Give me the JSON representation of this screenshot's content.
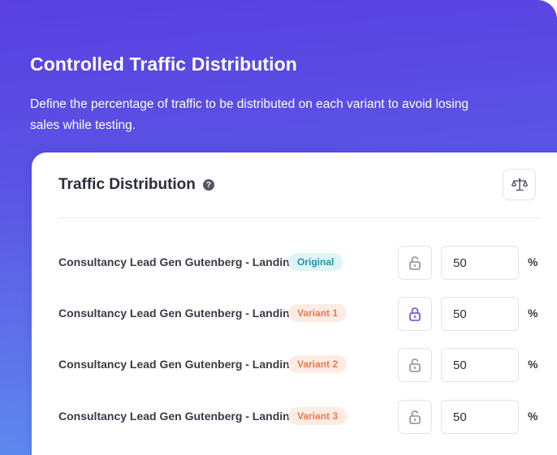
{
  "hero": {
    "title": "Controlled Traffic Distribution",
    "description": "Define the percentage of traffic to be distributed on each variant to avoid losing sales while testing."
  },
  "panel": {
    "title": "Traffic Distribution",
    "help_icon": "question-circle-icon",
    "balance_icon": "scale-icon",
    "help_glyph": "?"
  },
  "colors": {
    "gradient_top": "#5a40e2",
    "gradient_bottom": "#5b92ef",
    "original_badge_bg": "#dff4f7",
    "original_badge_text": "#1d95a6",
    "variant_badge_bg": "#fdece4",
    "variant_badge_text": "#ee7849",
    "lock_active": "#6b46d9",
    "lock_inactive": "#8a8e99"
  },
  "rows": [
    {
      "name": "Consultancy Lead Gen Gutenberg - Landing",
      "badge": "Original",
      "badge_type": "original",
      "locked": false,
      "value": "50",
      "unit": "%"
    },
    {
      "name": "Consultancy Lead Gen Gutenberg - Landing",
      "badge": "Variant 1",
      "badge_type": "variant",
      "locked": true,
      "value": "50",
      "unit": "%"
    },
    {
      "name": "Consultancy Lead Gen Gutenberg - Landing",
      "badge": "Variant 2",
      "badge_type": "variant",
      "locked": false,
      "value": "50",
      "unit": "%"
    },
    {
      "name": "Consultancy Lead Gen Gutenberg - Landing",
      "badge": "Variant 3",
      "badge_type": "variant",
      "locked": false,
      "value": "50",
      "unit": "%"
    }
  ]
}
